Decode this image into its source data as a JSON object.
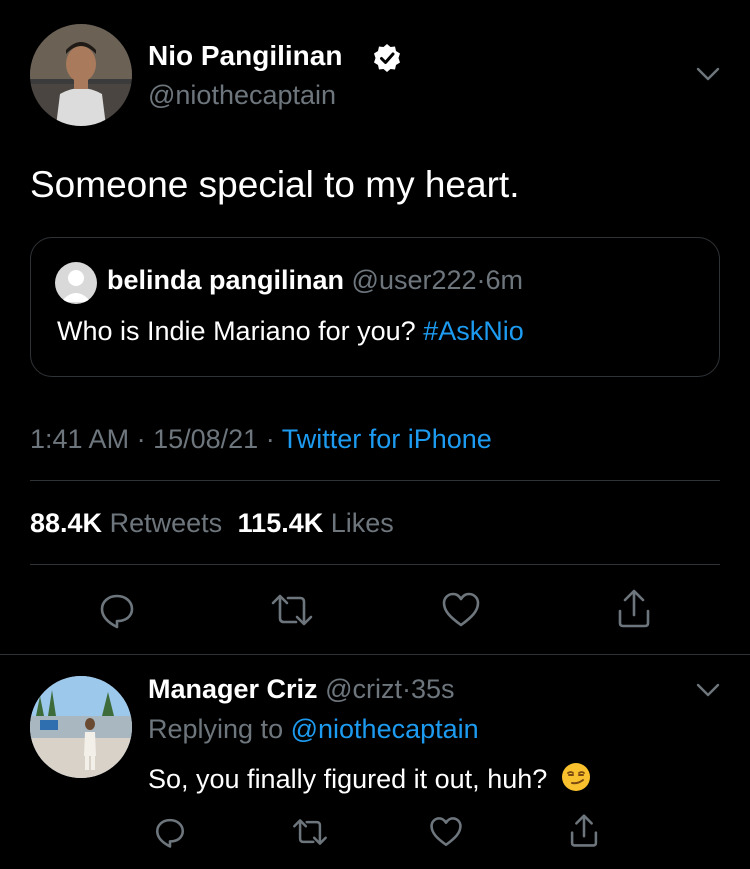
{
  "tweet": {
    "author_name": "Nio Pangilinan",
    "author_handle": "@niothecaptain",
    "text": "Someone special to my heart.",
    "time": "1:41 AM",
    "date": "15/08/21",
    "source": "Twitter for iPhone",
    "dot": "·",
    "retweet_count": "88.4K",
    "retweet_label": "Retweets",
    "like_count": "115.4K",
    "like_label": "Likes"
  },
  "quoted": {
    "name": "belinda pangilinan",
    "handle": "@user222",
    "dot": "·",
    "time": "6m",
    "text": "Who is Indie Mariano for you?",
    "hashtag": "#AskNio"
  },
  "reply": {
    "name": "Manager Criz",
    "handle": "@crizt",
    "dot": "·",
    "time": "35s",
    "replying_prefix": "Replying to",
    "replying_to": "@niothecaptain",
    "text": "So, you finally figured it out, huh?",
    "emoji": "😏"
  },
  "icons": {
    "verified": "verified-badge-icon",
    "more": "chevron-down-icon",
    "reply": "reply-icon",
    "retweet": "retweet-icon",
    "like": "heart-icon",
    "share": "share-icon"
  },
  "colors": {
    "background": "#000000",
    "muted": "#6e767d",
    "accent": "#1d9bf0",
    "divider": "#2f3336"
  }
}
